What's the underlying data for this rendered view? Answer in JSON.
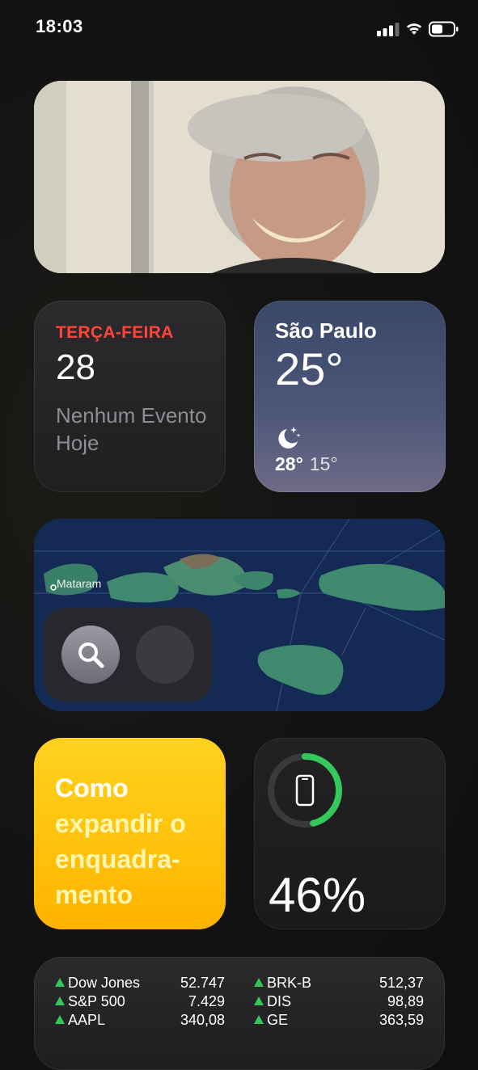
{
  "status_bar": {
    "time": "18:03"
  },
  "calendar": {
    "day": "TERÇA-FEIRA",
    "date": "28",
    "event": "Nenhum Evento Hoje"
  },
  "weather": {
    "city": "São Paulo",
    "temp": "25°",
    "high": "28°",
    "low": "15°",
    "icon": "moon-stars-icon"
  },
  "map": {
    "label": "Mataram"
  },
  "tip": {
    "line1": "Como",
    "rest": "expandir o enquadra-mento"
  },
  "battery": {
    "percent": "46%",
    "level": 0.46
  },
  "stocks": {
    "left": [
      {
        "symbol": "Dow Jones",
        "value": "52.747"
      },
      {
        "symbol": "S&P 500",
        "value": "7.429"
      },
      {
        "symbol": "AAPL",
        "value": "340,08"
      }
    ],
    "right": [
      {
        "symbol": "BRK-B",
        "value": "512,37"
      },
      {
        "symbol": "DIS",
        "value": "98,89"
      },
      {
        "symbol": "GE",
        "value": "363,59"
      }
    ]
  },
  "colors": {
    "calendar_day": "#ff453a",
    "battery_ring": "#34c759",
    "tip_bg": "#ffc20c"
  }
}
